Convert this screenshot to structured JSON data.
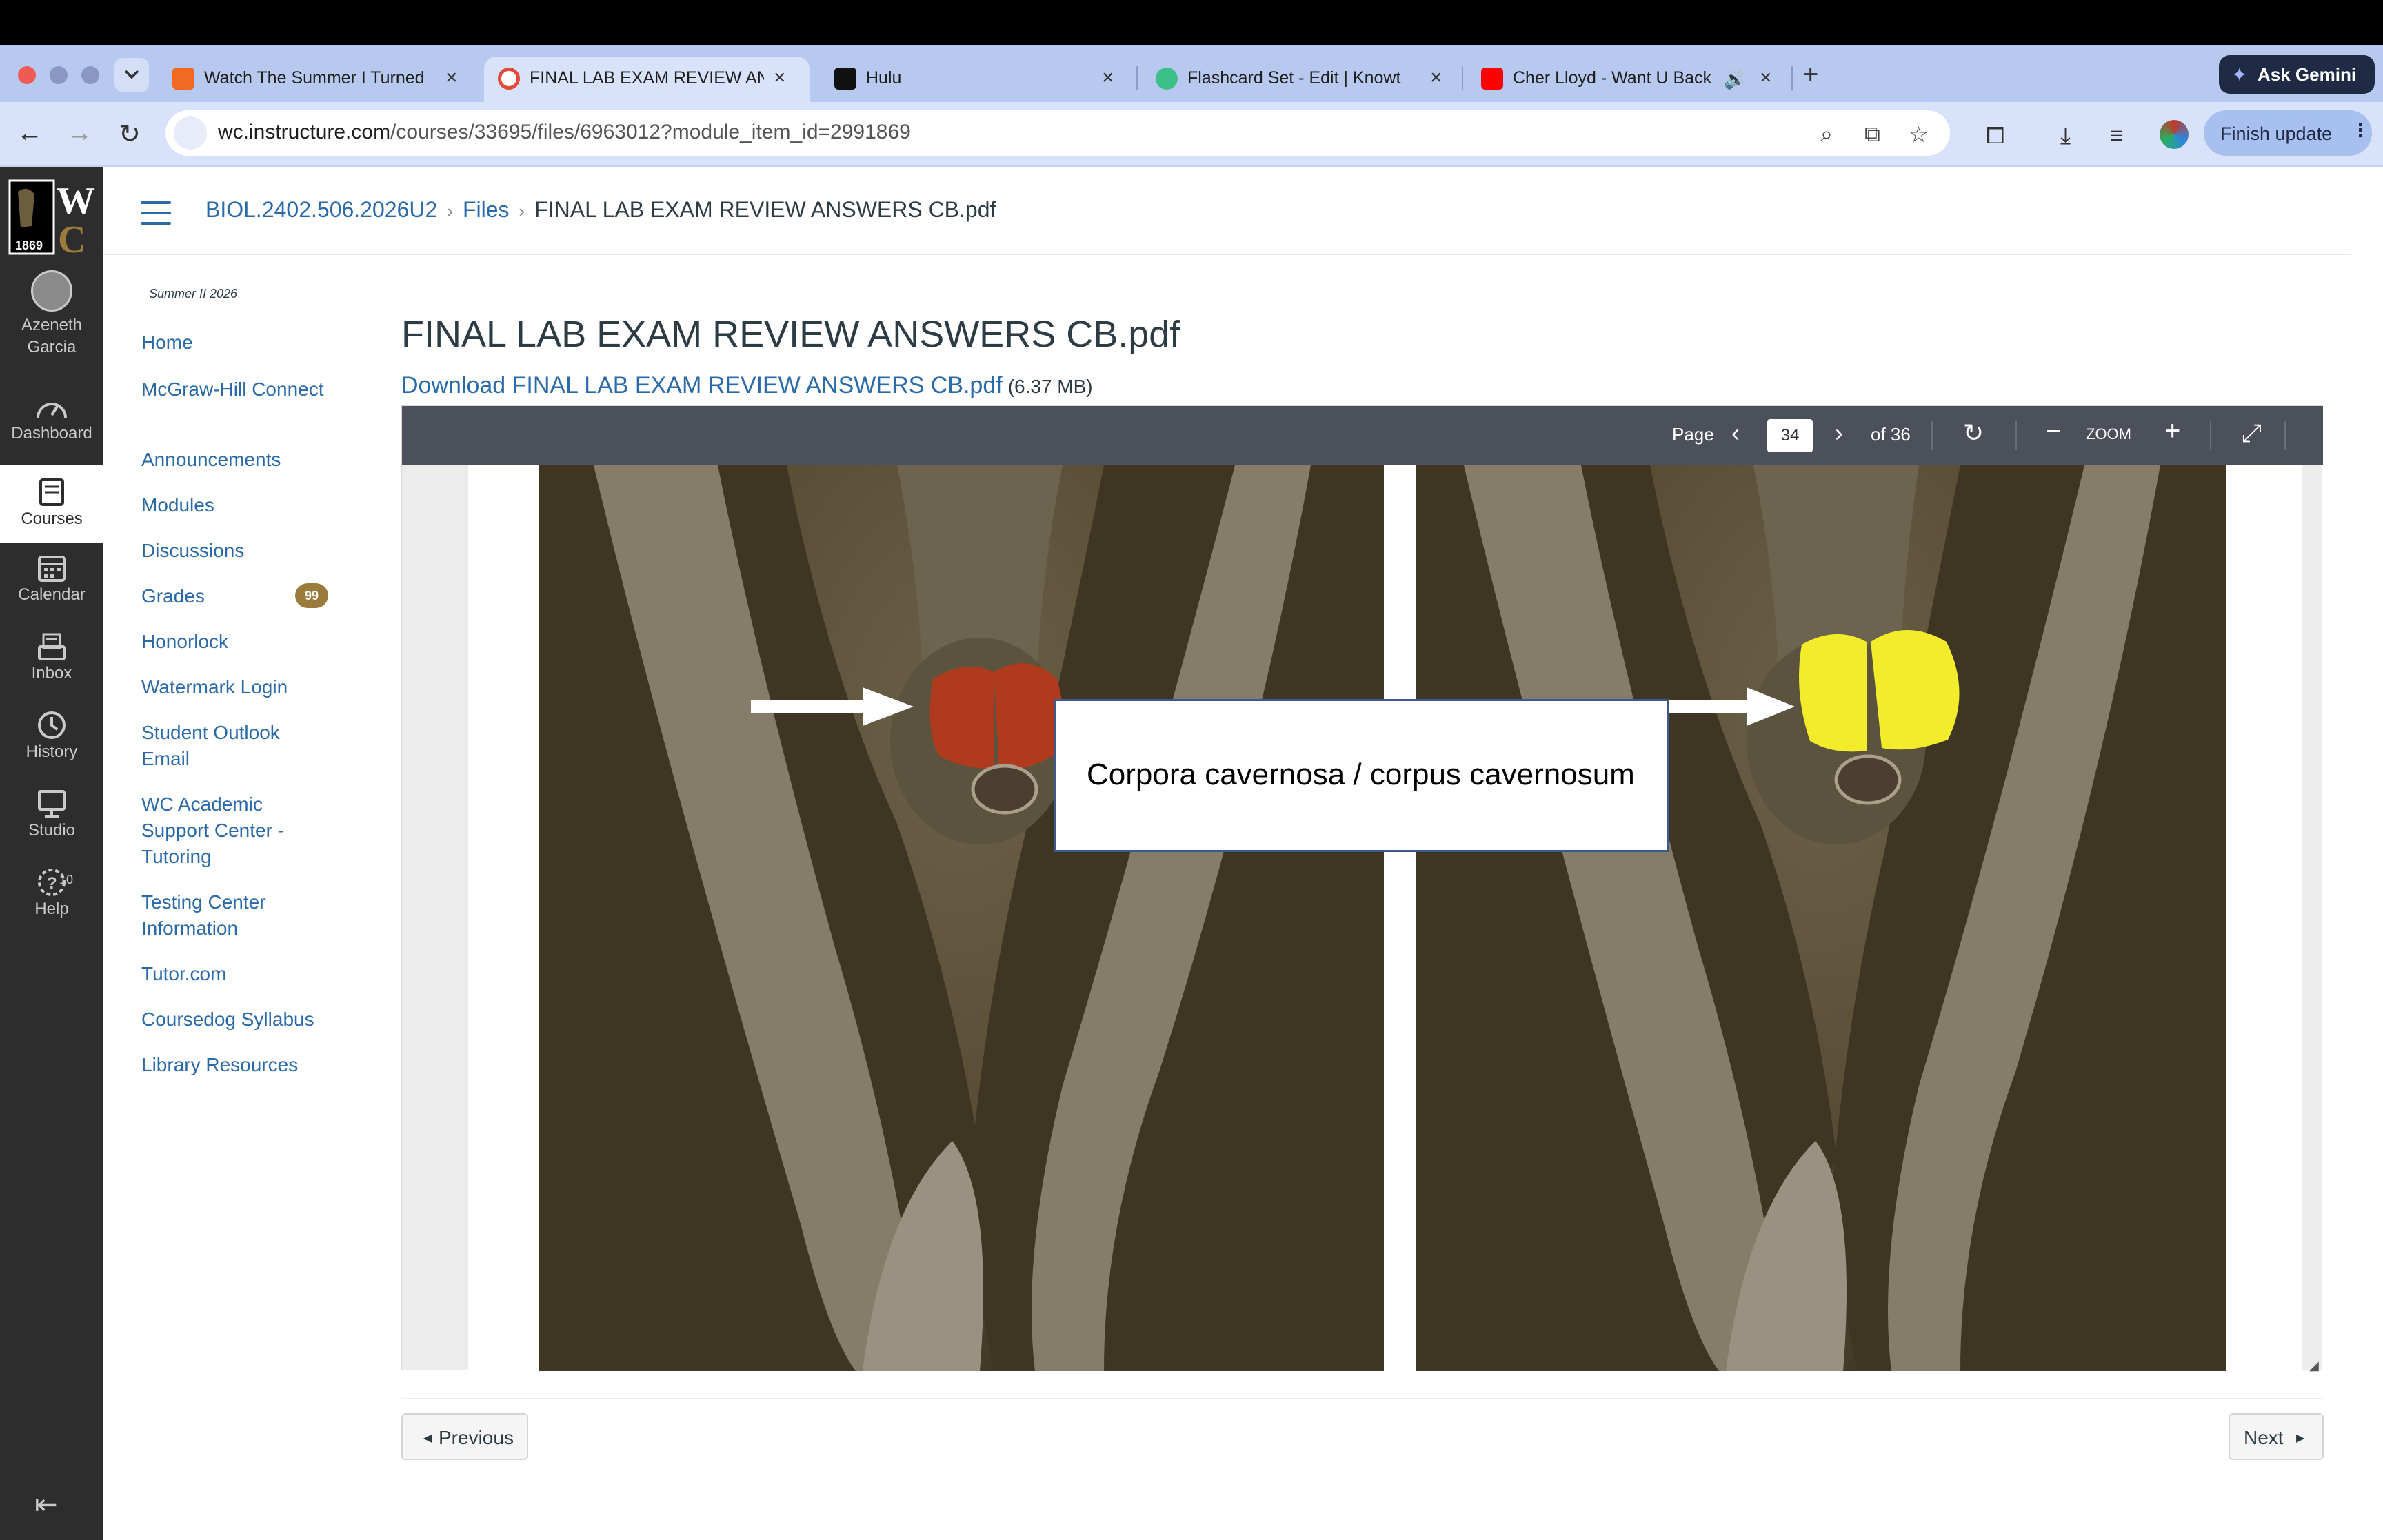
{
  "browser": {
    "tabs": [
      {
        "title": "Watch The Summer I Turned I",
        "active": false
      },
      {
        "title": "FINAL LAB EXAM REVIEW AN",
        "active": true
      },
      {
        "title": "Hulu",
        "active": false
      },
      {
        "title": "Flashcard Set - Edit | Knowt",
        "active": false
      },
      {
        "title": "Cher Lloyd - Want U Back",
        "active": false
      }
    ],
    "ask_gemini": "Ask Gemini",
    "url_host": "wc.instructure.com",
    "url_path": "/courses/33695/files/6963012?module_item_id=2991869",
    "finish_update": "Finish update",
    "accent_color": "#a8c0f0"
  },
  "global_nav": {
    "logo_year": "1869",
    "items": [
      {
        "label": "Azeneth Garcia",
        "icon": "user-avatar-icon"
      },
      {
        "label": "Dashboard",
        "icon": "dashboard-icon"
      },
      {
        "label": "Courses",
        "icon": "courses-icon"
      },
      {
        "label": "Calendar",
        "icon": "calendar-icon"
      },
      {
        "label": "Inbox",
        "icon": "inbox-icon"
      },
      {
        "label": "History",
        "icon": "history-icon"
      },
      {
        "label": "Studio",
        "icon": "studio-icon"
      },
      {
        "label": "Help",
        "icon": "help-icon"
      }
    ],
    "help_badge": "10"
  },
  "breadcrumb": {
    "course": "BIOL.2402.506.2026U2",
    "files": "Files",
    "current": "FINAL LAB EXAM REVIEW ANSWERS CB.pdf"
  },
  "course_nav": {
    "term": "Summer II 2026",
    "items": [
      "Home",
      "McGraw-Hill Connect",
      "Announcements",
      "Modules",
      "Discussions",
      "Grades",
      "Honorlock",
      "Watermark Login",
      "Student Outlook Email",
      "WC Academic Support Center - Tutoring",
      "Testing Center Information",
      "Tutor.com",
      "Coursedog Syllabus",
      "Library Resources"
    ],
    "grades_badge": "99"
  },
  "file": {
    "title": "FINAL LAB EXAM REVIEW ANSWERS CB.pdf",
    "download_text": "Download FINAL LAB EXAM REVIEW ANSWERS CB.pdf",
    "size": "(6.37 MB)"
  },
  "viewer": {
    "page_label": "Page",
    "page_number": "34",
    "page_of": "of 36",
    "zoom_label": "ZOOM",
    "slide_label": "Corpora cavernosa / corpus cavernosum"
  },
  "pager": {
    "previous": "Previous",
    "next": "Next"
  }
}
